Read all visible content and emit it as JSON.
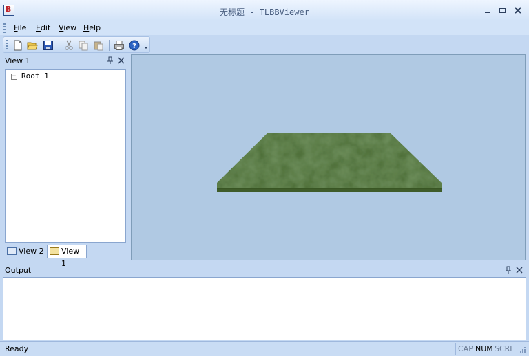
{
  "window": {
    "title": "无标题 - TLBBViewer",
    "app_icon": "B"
  },
  "menu": {
    "items": [
      "File",
      "Edit",
      "View",
      "Help"
    ],
    "mnemonics": [
      "F",
      "E",
      "V",
      "H"
    ]
  },
  "toolbar": {
    "icons": [
      "new-icon",
      "open-icon",
      "save-icon",
      "cut-icon",
      "copy-icon",
      "paste-icon",
      "print-icon",
      "help-icon",
      "overflow-icon"
    ]
  },
  "left_panel": {
    "title": "View 1",
    "tree": [
      {
        "label": "Root 1",
        "expander": "+"
      }
    ],
    "tabs": [
      {
        "label": "View 2",
        "active": false
      },
      {
        "label": "View 1",
        "active": true
      }
    ]
  },
  "viewport": {
    "background": "#b0c9e3",
    "terrain_color": "#4a6b33"
  },
  "output_panel": {
    "title": "Output"
  },
  "statusbar": {
    "text": "Ready",
    "indicators": [
      "CAP",
      "NUM",
      "SCRL"
    ],
    "active_indicator": "NUM"
  },
  "colors": {
    "chrome": "#c4d8f2",
    "accent": "#2a4e8c",
    "border": "#8aa6cf"
  }
}
